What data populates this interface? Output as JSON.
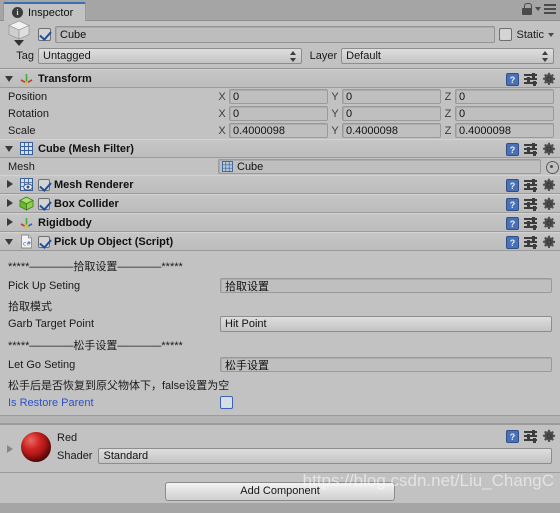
{
  "window": {
    "tab_label": "Inspector",
    "tab_icon": "info-icon",
    "lock_icon": "lock-icon",
    "menu_icon": "hamburger-menu-icon"
  },
  "header": {
    "object_icon": "cube-icon",
    "enabled": true,
    "name": "Cube",
    "static_label": "Static",
    "static_checked": false,
    "tag_label": "Tag",
    "tag_value": "Untagged",
    "layer_label": "Layer",
    "layer_value": "Default"
  },
  "components": [
    {
      "id": "transform",
      "title": "Transform",
      "icon": "transform-axis-icon",
      "expanded": true,
      "has_enable_checkbox": false,
      "rows": [
        {
          "label": "Position",
          "axes": [
            "X",
            "Y",
            "Z"
          ],
          "values": [
            "0",
            "0",
            "0"
          ]
        },
        {
          "label": "Rotation",
          "axes": [
            "X",
            "Y",
            "Z"
          ],
          "values": [
            "0",
            "0",
            "0"
          ]
        },
        {
          "label": "Scale",
          "axes": [
            "X",
            "Y",
            "Z"
          ],
          "values": [
            "0.4000098",
            "0.4000098",
            "0.4000098"
          ]
        }
      ]
    },
    {
      "id": "mesh-filter",
      "title": "Cube (Mesh Filter)",
      "icon": "mesh-filter-icon",
      "expanded": true,
      "has_enable_checkbox": false,
      "mesh_label": "Mesh",
      "mesh_value": "Cube",
      "mesh_value_icon": "mesh-icon"
    },
    {
      "id": "mesh-renderer",
      "title": "Mesh Renderer",
      "icon": "mesh-renderer-icon",
      "expanded": false,
      "has_enable_checkbox": true,
      "enabled": true
    },
    {
      "id": "box-collider",
      "title": "Box Collider",
      "icon": "box-collider-icon",
      "expanded": false,
      "has_enable_checkbox": true,
      "enabled": true
    },
    {
      "id": "rigidbody",
      "title": "Rigidbody",
      "icon": "rigidbody-icon",
      "expanded": false,
      "has_enable_checkbox": false
    },
    {
      "id": "pick-up-object",
      "title": "Pick Up Object (Script)",
      "icon": "csharp-script-icon",
      "expanded": true,
      "has_enable_checkbox": true,
      "enabled": true
    }
  ],
  "script": {
    "separator_pickup": "*****————拾取设置————*****",
    "pick_up_seting_label": "Pick Up Seting",
    "pick_up_seting_value": "拾取设置",
    "garb_mode_note": "拾取模式",
    "garb_target_point_label": "Garb Target Point",
    "garb_target_point_value": "Hit Point",
    "separator_letgo": "*****————松手设置————*****",
    "let_go_seting_label": "Let Go Seting",
    "let_go_seting_value": "松手设置",
    "restore_note": "松手后是否恢复到原父物体下，false设置为空",
    "is_restore_parent_label": "Is Restore Parent",
    "is_restore_parent_checked": false
  },
  "material": {
    "name": "Red",
    "preview_icon": "material-sphere-icon",
    "shader_label": "Shader",
    "shader_value": "Standard"
  },
  "footer": {
    "add_component_label": "Add Component"
  },
  "watermark": "https://blog.csdn.net/Liu_ChangC",
  "icons": {
    "help": "?",
    "preset": "preset-sliders-icon",
    "gear": "gear-icon"
  },
  "colors": {
    "panel_bg": "#c2c2c2",
    "chrome_bg": "#a5a5a5",
    "tab_accent": "#3b6fb5",
    "link_blue": "#2c52c8",
    "material_red": "#cf2320"
  }
}
